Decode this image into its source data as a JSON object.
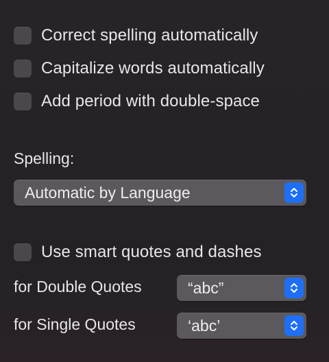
{
  "checkboxes": {
    "correct_spelling": "Correct spelling automatically",
    "capitalize_words": "Capitalize words automatically",
    "add_period": "Add period with double-space",
    "smart_quotes": "Use smart quotes and dashes"
  },
  "spelling": {
    "label": "Spelling:",
    "selected": "Automatic by Language"
  },
  "double_quotes": {
    "label": "for Double Quotes",
    "selected": "“abc”"
  },
  "single_quotes": {
    "label": "for Single Quotes",
    "selected": "‘abc’"
  },
  "colors": {
    "background": "#252327",
    "checkbox": "#4a484d",
    "popup": "#5b595e",
    "accent": "#1e6ff5"
  },
  "icons": {
    "popup_arrows": "chevron-up-down-icon"
  }
}
